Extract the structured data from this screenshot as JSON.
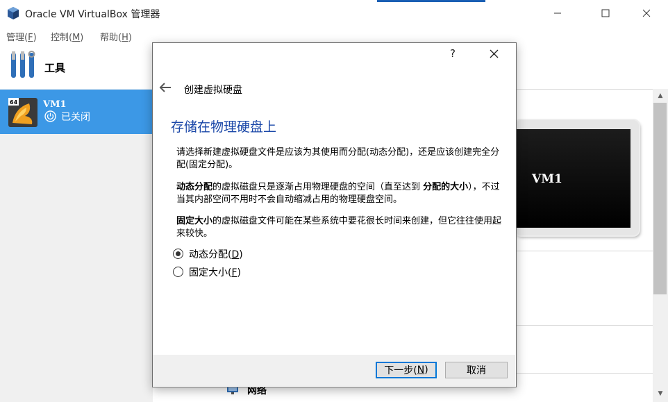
{
  "window": {
    "title": "Oracle VM VirtualBox 管理器",
    "minimize_icon": "minimize-icon",
    "maximize_icon": "maximize-icon",
    "close_icon": "close-icon"
  },
  "menu": [
    {
      "label": "管理(",
      "key": "F",
      "end": ")"
    },
    {
      "label": "控制(",
      "key": "M",
      "end": ")"
    },
    {
      "label": "帮助(",
      "key": "H",
      "end": ")"
    }
  ],
  "sidebar": {
    "tools_label": "工具",
    "vm": {
      "name": "VM1",
      "badge": "64",
      "state": "已关闭"
    }
  },
  "preview": {
    "label": "VM1"
  },
  "details": {
    "network_label": "网络"
  },
  "dialog": {
    "help": "?",
    "title": "创建虚拟硬盘",
    "heading": "存储在物理硬盘上",
    "paragraph1": "请选择新建虚拟硬盘文件是应该为其使用而分配(动态分配)，还是应该创建完全分配(固定分配)。",
    "paragraph2_bold1": "动态分配",
    "paragraph2_text1": "的虚拟磁盘只是逐渐占用物理硬盘的空间（直至达到 ",
    "paragraph2_bold2": "分配的大小",
    "paragraph2_text2": "），不过当其内部空间不用时不会自动缩减占用的物理硬盘空间。",
    "paragraph3_bold": "固定大小",
    "paragraph3_text": "的虚拟磁盘文件可能在某些系统中要花很长时间来创建，但它往往使用起来较快。",
    "options": [
      {
        "label": "动态分配(",
        "key": "D",
        "end": ")",
        "selected": true
      },
      {
        "label": "固定大小(",
        "key": "F",
        "end": ")",
        "selected": false
      }
    ],
    "next_button": {
      "label": "下一步(",
      "key": "N",
      "end": ")"
    },
    "cancel_button": "取消"
  },
  "colors": {
    "selection": "#3c98e6",
    "heading": "#1a47a8",
    "primary_border": "#0078d7"
  }
}
